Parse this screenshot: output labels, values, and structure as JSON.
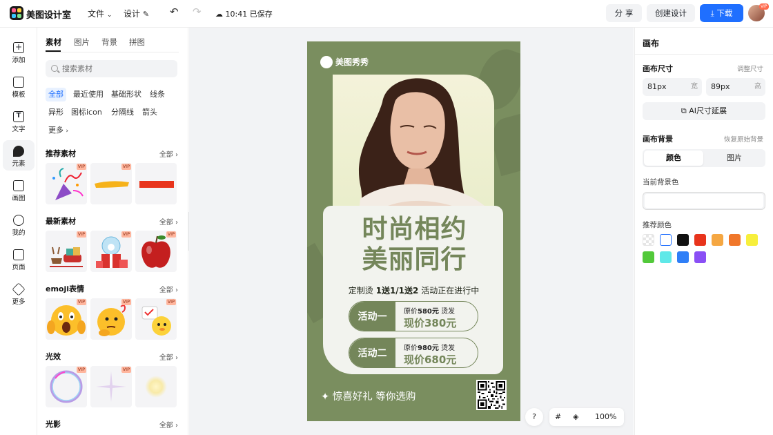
{
  "app": {
    "name": "美图设计室"
  },
  "toolbar": {
    "file_menu": "文件",
    "design_menu": "设计",
    "save_status": "10:41 已保存",
    "share_label": "分 享",
    "create_label": "创建设计",
    "download_label": "下载",
    "vip_badge": "VIP"
  },
  "rail": [
    {
      "icon": "add-icon",
      "label": "添加"
    },
    {
      "icon": "template-icon",
      "label": "模板"
    },
    {
      "icon": "text-icon",
      "label": "文字"
    },
    {
      "icon": "element-icon",
      "label": "元素"
    },
    {
      "icon": "paint-icon",
      "label": "画图"
    },
    {
      "icon": "user-icon",
      "label": "我的"
    },
    {
      "icon": "page-icon",
      "label": "页面"
    },
    {
      "icon": "more-icon",
      "label": "更多"
    }
  ],
  "panel": {
    "tabs": [
      "素材",
      "图片",
      "背景",
      "拼图"
    ],
    "search_placeholder": "搜索素材",
    "chips": [
      "全部",
      "最近使用",
      "基础形状",
      "线条",
      "异形",
      "图标icon",
      "分隔线",
      "箭头",
      "更多"
    ],
    "all_label": "全部",
    "vip_label": "VIP",
    "sections": [
      {
        "title": "推荐素材",
        "items": [
          "party-popper",
          "yellow-brush-stroke",
          "red-stripe"
        ]
      },
      {
        "title": "最新素材",
        "items": [
          "christmas-sleigh",
          "snow-globe-gift",
          "red-apple"
        ]
      },
      {
        "title": "emoji表情",
        "items": [
          "shocked-emoji",
          "thinking-emoji",
          "duck-emoji"
        ]
      },
      {
        "title": "光效",
        "items": [
          "bubble-ring",
          "sparkle-star",
          "glow-spot"
        ]
      },
      {
        "title": "光影",
        "items": []
      }
    ]
  },
  "poster": {
    "brand": "美图秀秀",
    "headline_1": "时尚相约",
    "headline_2": "美丽同行",
    "promo_prefix": "定制烫",
    "promo_bold": "1送1/1送2",
    "promo_suffix": "活动正在进行中",
    "activity_1": {
      "label": "活动一",
      "original_prefix": "原价",
      "original_price": "580元",
      "original_suffix": "烫发",
      "current": "现价380元"
    },
    "activity_2": {
      "label": "活动二",
      "original_prefix": "原价",
      "original_price": "980元",
      "original_suffix": "烫发",
      "current": "现价680元"
    },
    "slogan": "惊喜好礼 等你选购",
    "colors": {
      "bg": "#7a8e5f",
      "accent": "#74865a",
      "card": "#f2f3ee"
    }
  },
  "controls": {
    "help": "?",
    "zoom": "100%"
  },
  "inspector": {
    "title": "画布",
    "size_label": "画布尺寸",
    "resize_link": "调整尺寸",
    "width_value": "81px",
    "width_unit": "宽",
    "height_value": "89px",
    "height_unit": "高",
    "ai_extend": "AI尺寸延展",
    "bg_label": "画布背景",
    "restore_link": "恢复原始背景",
    "bg_tabs": [
      "颜色",
      "图片"
    ],
    "current_bg_label": "当前背景色",
    "recommend_label": "推荐颜色",
    "swatches": [
      "transparent",
      "#ffffff",
      "#111111",
      "#e8341c",
      "#f5a742",
      "#f0772a",
      "#f7ef3c",
      "#52c93a",
      "#5fe8e8",
      "#2f7ff7",
      "#8a4ff5"
    ]
  },
  "accent": "#1f6fff"
}
